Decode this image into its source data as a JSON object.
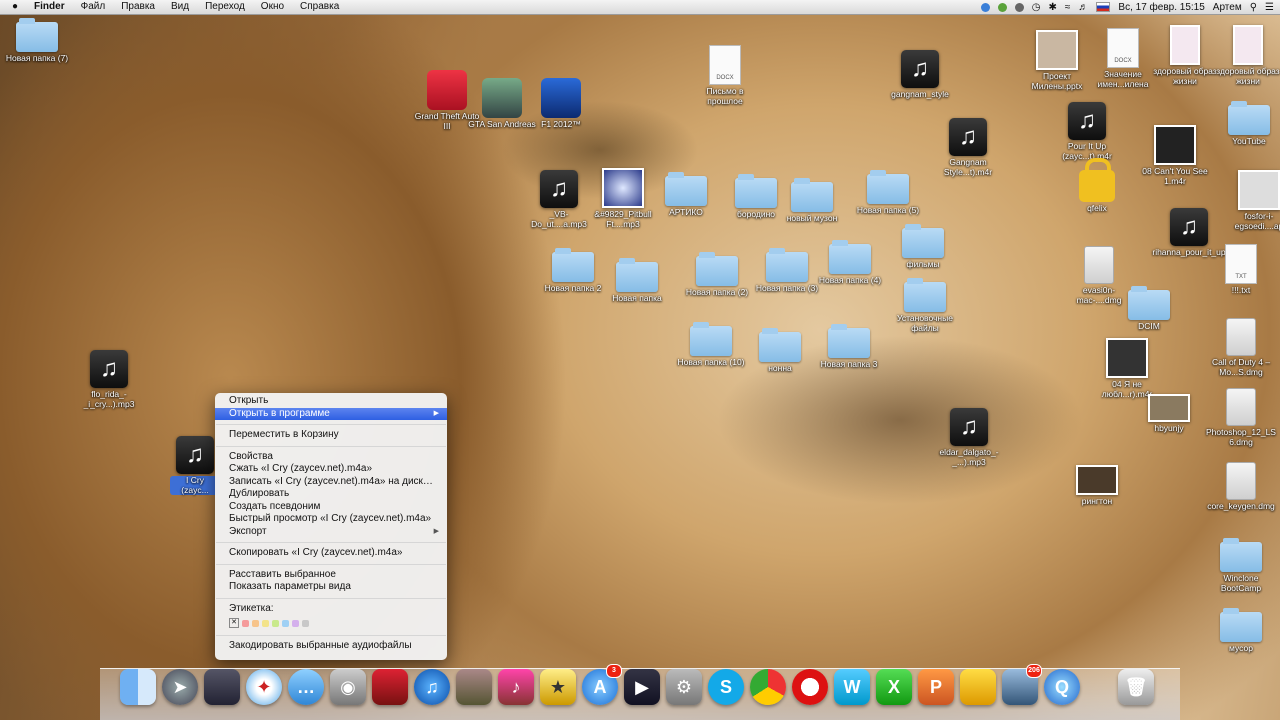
{
  "menubar": {
    "apple": "",
    "app": "Finder",
    "items": [
      "Файл",
      "Правка",
      "Вид",
      "Переход",
      "Окно",
      "Справка"
    ],
    "clock": "Вс, 17 февр.  15:15",
    "user": "Артем"
  },
  "desktop_icons": [
    {
      "name": "Новая папка\n(7)",
      "kind": "folder"
    },
    {
      "name": "Grand Theft Auto III",
      "kind": "app"
    },
    {
      "name": "GTA San Andreas",
      "kind": "app"
    },
    {
      "name": "F1 2012™",
      "kind": "app"
    },
    {
      "name": "Письмо в прошлое",
      "kind": "doc"
    },
    {
      "name": "gangnam_style",
      "kind": "music"
    },
    {
      "name": "Проект Милены.pptx",
      "kind": "thumb"
    },
    {
      "name": "Значение имен...илена",
      "kind": "doc"
    },
    {
      "name": "здоровый образ жизни",
      "kind": "thumb"
    },
    {
      "name": "здоровый образ жизни",
      "kind": "thumb"
    },
    {
      "name": "Gangnam Style...t).m4r",
      "kind": "music"
    },
    {
      "name": "Pour It Up (zayc...t).m4r",
      "kind": "music"
    },
    {
      "name": "08 Can't You See 1.m4r",
      "kind": "thumb"
    },
    {
      "name": "YouTube",
      "kind": "folder"
    },
    {
      "name": "_VB-Do_ut....a.mp3",
      "kind": "music"
    },
    {
      "name": "&#9829_Pitbull Ft....mp3",
      "kind": "thumb"
    },
    {
      "name": "АРТИКО",
      "kind": "folder"
    },
    {
      "name": "бородино",
      "kind": "folder"
    },
    {
      "name": "новый музон",
      "kind": "folder"
    },
    {
      "name": "Новая папка (5)",
      "kind": "folder"
    },
    {
      "name": "qfelix",
      "kind": "lock"
    },
    {
      "name": "fosfor-i-egsoedi....ap",
      "kind": "thumb"
    },
    {
      "name": "фильмы",
      "kind": "folder"
    },
    {
      "name": "rihanna_pour_it_up",
      "kind": "music"
    },
    {
      "name": "Новая папка 2",
      "kind": "folder"
    },
    {
      "name": "Новая папка",
      "kind": "folder"
    },
    {
      "name": "Новая папка (2)",
      "kind": "folder"
    },
    {
      "name": "Новая папка (3)",
      "kind": "folder"
    },
    {
      "name": "Новая папка (4)",
      "kind": "folder"
    },
    {
      "name": "evasi0n-mac-....dmg",
      "kind": "disk"
    },
    {
      "name": "!!!.txt",
      "kind": "doc"
    },
    {
      "name": "Установочные файлы",
      "kind": "folder"
    },
    {
      "name": "DCIM",
      "kind": "folder"
    },
    {
      "name": "Новая папка (10)",
      "kind": "folder"
    },
    {
      "name": "нонна",
      "kind": "folder"
    },
    {
      "name": "Новая папка 3",
      "kind": "folder"
    },
    {
      "name": "Call of Duty 4 – Mo...S.dmg",
      "kind": "disk"
    },
    {
      "name": "04 Я не любл...r).m4r",
      "kind": "thumb"
    },
    {
      "name": "flo_rida_-_i_cry...).mp3",
      "kind": "music"
    },
    {
      "name": "hbyunjy",
      "kind": "thumb"
    },
    {
      "name": "Photoshop_12_LS6.dmg",
      "kind": "disk"
    },
    {
      "name": "eldar_dalgato_-_...).mp3",
      "kind": "music"
    },
    {
      "name": "рингтон",
      "kind": "thumb"
    },
    {
      "name": "core_keygen.dmg",
      "kind": "disk"
    },
    {
      "name": "Winclone BootCamp",
      "kind": "folder"
    },
    {
      "name": "мусор",
      "kind": "folder"
    },
    {
      "name": "I Cry (zayc...",
      "kind": "music"
    }
  ],
  "context_menu": {
    "open": "Открыть",
    "open_with": "Открыть в программе",
    "move_to_trash": "Переместить в Корзину",
    "get_info": "Свойства",
    "compress": "Сжать «I Cry  (zaycev.net).m4a»",
    "burn": "Записать «I Cry  (zaycev.net).m4a» на диск…",
    "duplicate": "Дублировать",
    "make_alias": "Создать псевдоним",
    "quick_look": "Быстрый просмотр «I Cry  (zaycev.net).m4a»",
    "share": "Экспорт",
    "copy": "Скопировать «I Cry  (zaycev.net).m4a»",
    "arrange": "Расставить выбранное",
    "view_options": "Показать параметры вида",
    "label": "Этикетка:",
    "label_none": "✕",
    "label_colors": [
      "#f59a9a",
      "#f7c48a",
      "#f3e38a",
      "#c9e98c",
      "#9fd0f4",
      "#d4b0ec",
      "#c8c8c8"
    ],
    "encode": "Закодировать выбранные аудиофайлы"
  },
  "dock": {
    "badges": {
      "appstore": "3",
      "iphoto": "206"
    }
  }
}
